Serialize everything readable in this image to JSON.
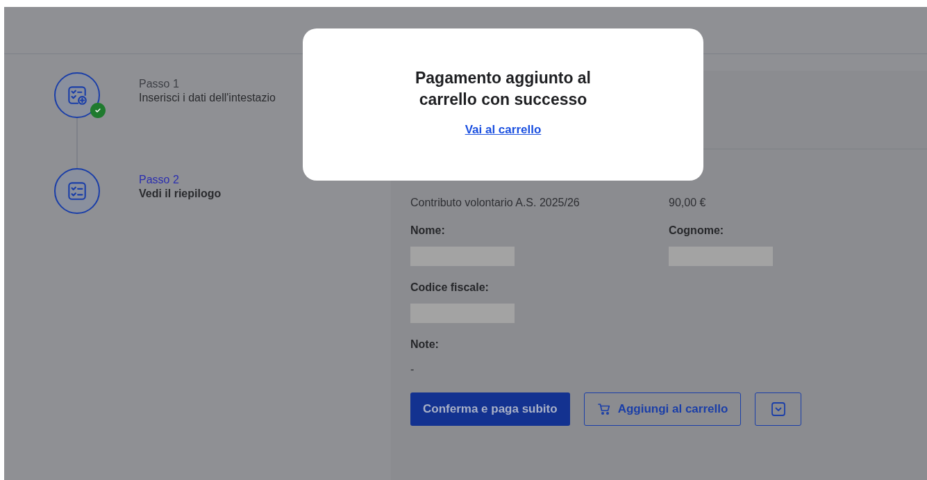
{
  "steps": [
    {
      "label": "Passo 1",
      "title": "Inserisci i dati dell'intestazio",
      "completed": true,
      "selected": false
    },
    {
      "label": "Passo 2",
      "title": "Vedi il riepilogo",
      "completed": false,
      "selected": true
    }
  ],
  "summary": {
    "rows": [
      [
        {
          "value": "Contributo volontario A.S. 2025/26"
        },
        {
          "value": "90,00 €"
        }
      ],
      [
        {
          "label": "Nome:",
          "redacted": true
        },
        {
          "label": "Cognome:",
          "redacted": true
        }
      ],
      [
        {
          "label": "Codice fiscale:",
          "redacted": true
        }
      ],
      [
        {
          "label": "Note:",
          "value": "-"
        }
      ]
    ]
  },
  "buttons": [
    {
      "kind": "primary",
      "label": "Conferma e paga subito"
    },
    {
      "kind": "cart",
      "label": "Aggiungi al carrello"
    },
    {
      "kind": "menu"
    }
  ],
  "modal": {
    "title": "Pagamento aggiunto al carrello con successo",
    "link": "Vai al carrello"
  }
}
